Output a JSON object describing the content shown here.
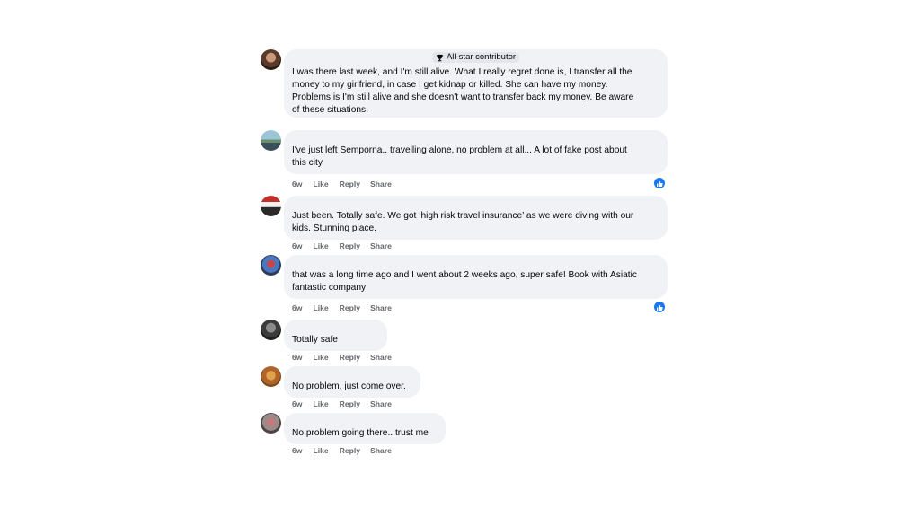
{
  "badge_label": "All-star contributor",
  "actions": {
    "like": "Like",
    "reply": "Reply",
    "share": "Share"
  },
  "comments": [
    {
      "text": "I was there last week, and I'm still alive. What I really regret done is, I transfer all the\nmoney to my girlfriend, in case I get kidnap or killed. She can have my money.\nProblems is I'm still alive and she doesn't want to transfer back my money. Be aware\nof these situations.",
      "time": ""
    },
    {
      "text": "I've just left Semporna.. travelling alone, no problem at all... A lot of fake post about\nthis city",
      "time": "6w",
      "reaction": "like-icon"
    },
    {
      "text": "Just been. Totally safe. We got ‘high risk travel insurance’ as we were diving with our\nkids. Stunning place.",
      "time": "6w"
    },
    {
      "text": "that was a long time ago and I went about 2 weeks ago, super safe! Book with Asiatic\nfantastic company",
      "time": "6w",
      "reaction": "like-icon"
    },
    {
      "text": "Totally safe",
      "time": "6w"
    },
    {
      "text": "No problem, just come over.",
      "time": "6w"
    },
    {
      "text": "No problem going there...trust me",
      "time": "6w"
    }
  ],
  "colors": {
    "bubble": "#f0f2f5",
    "meta": "#65676b",
    "like_blue": "#1877f2"
  }
}
